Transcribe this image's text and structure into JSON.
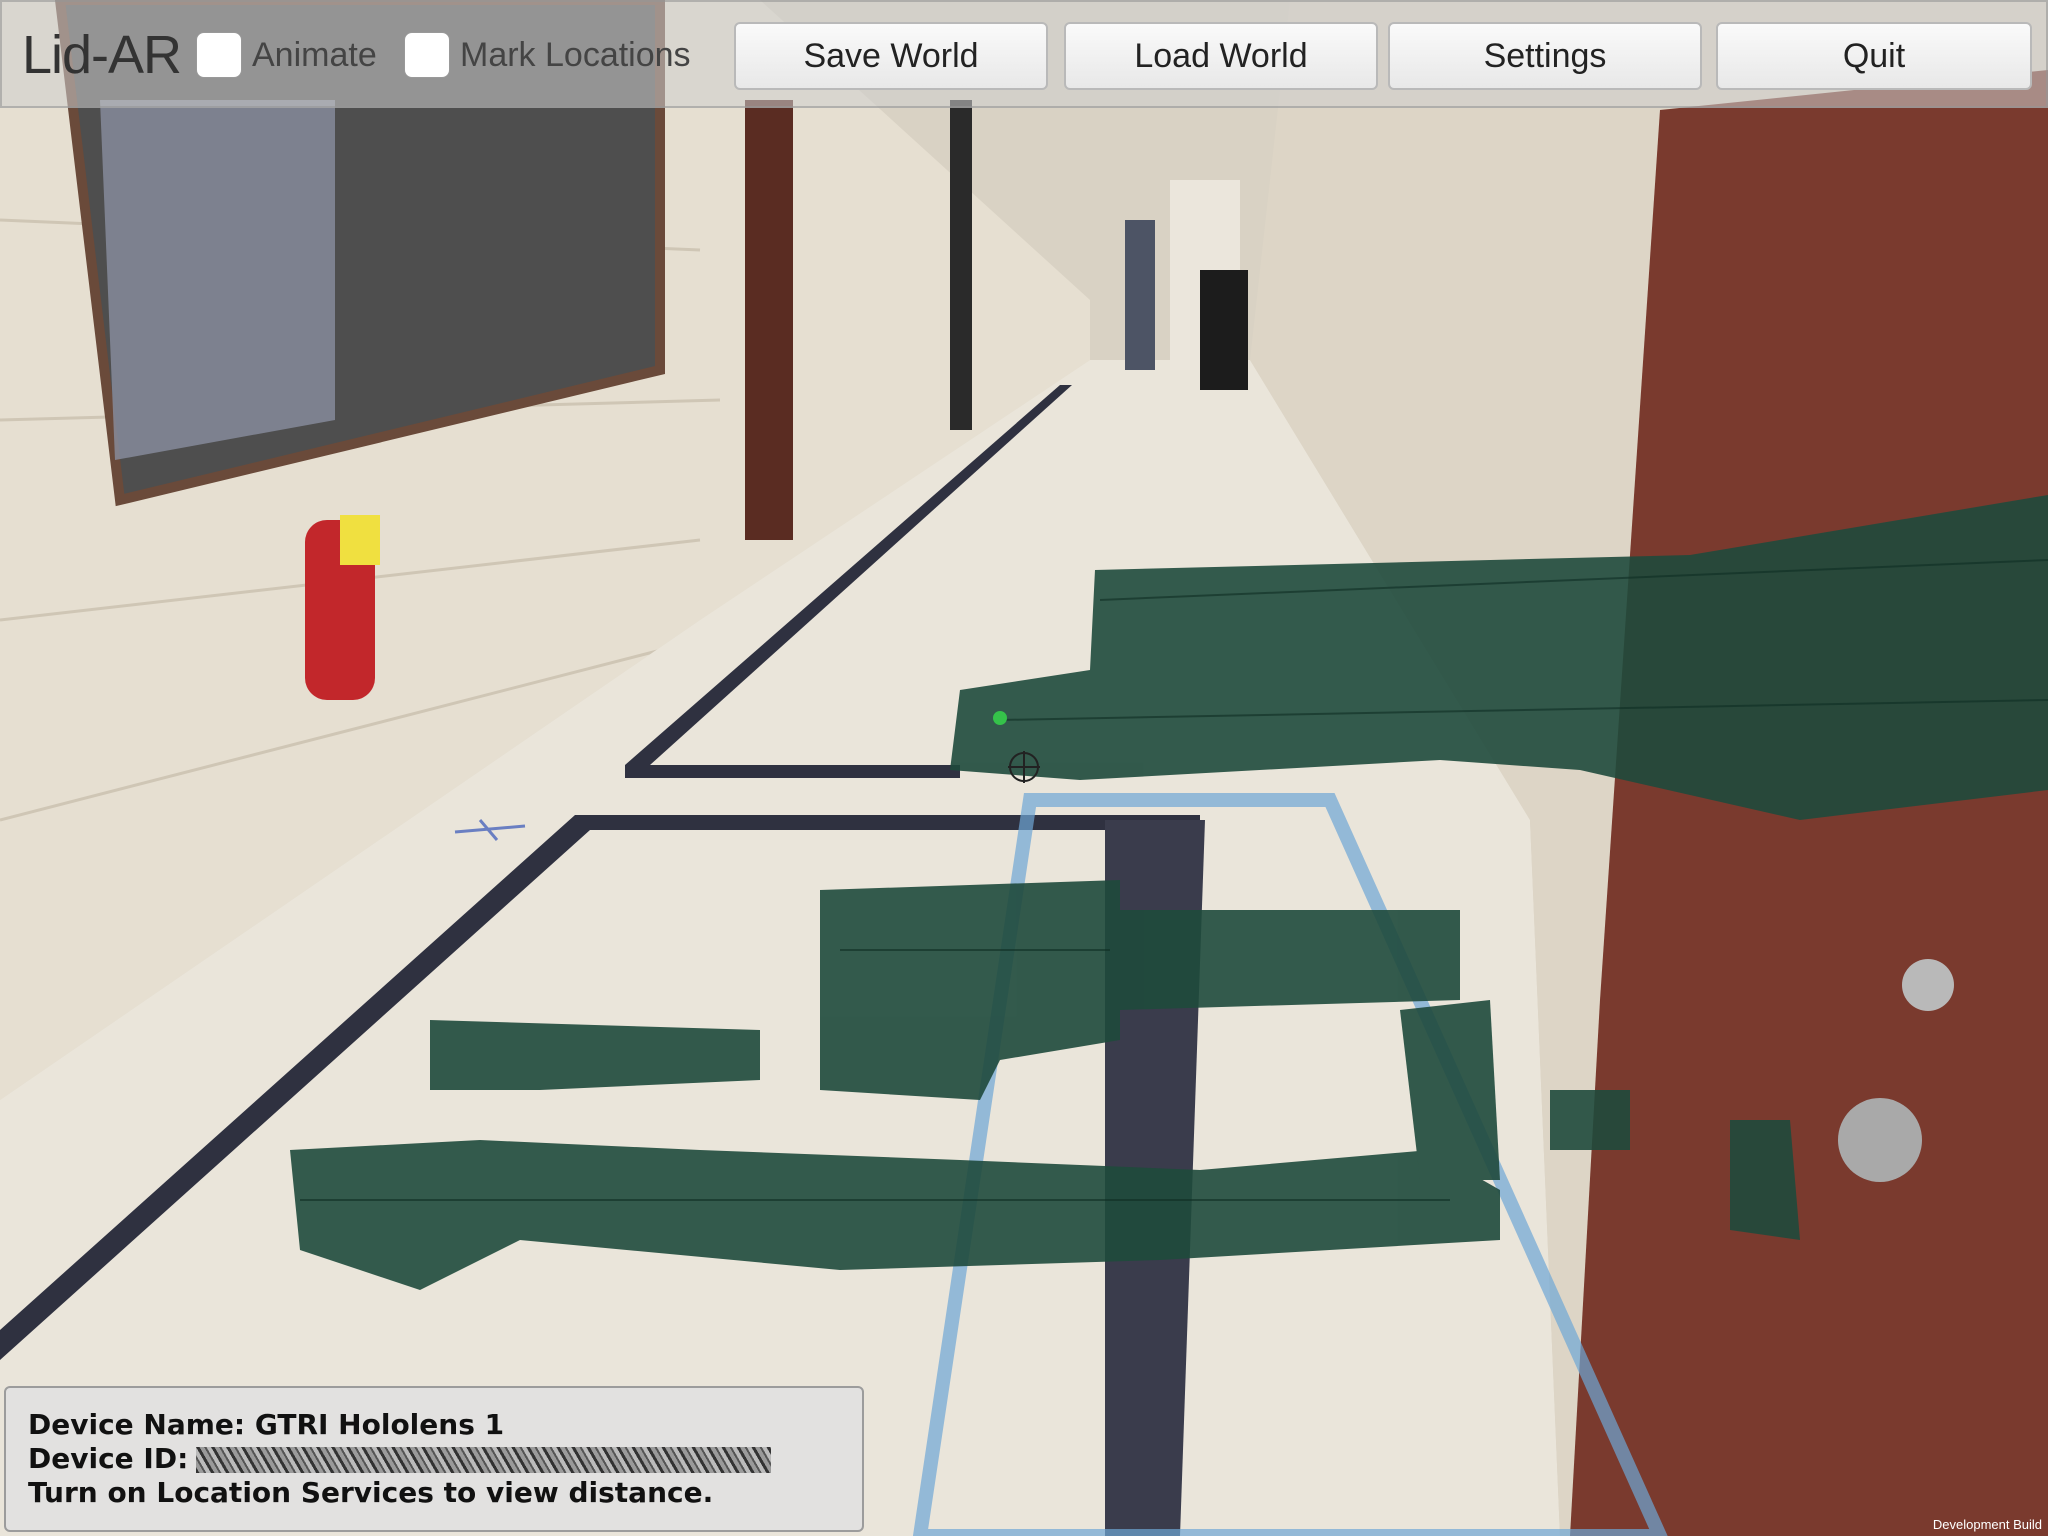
{
  "app": {
    "title": "Lid-AR"
  },
  "toolbar": {
    "animate_label": "Animate",
    "mark_locations_label": "Mark Locations",
    "save_world_label": "Save World",
    "load_world_label": "Load World",
    "settings_label": "Settings",
    "quit_label": "Quit"
  },
  "info": {
    "device_name": "Device Name: GTRI Hololens 1",
    "device_id_label": "Device ID:",
    "location_notice": "Turn on Location Services to view distance."
  },
  "footer": {
    "build_label": "Development Build"
  },
  "colors": {
    "mesh": "#1f4a3c",
    "wall": "#e4dccd",
    "door": "#7a3a2e"
  },
  "icons": [
    "checkbox-icon",
    "marker-dot-icon",
    "crosshair-icon"
  ]
}
